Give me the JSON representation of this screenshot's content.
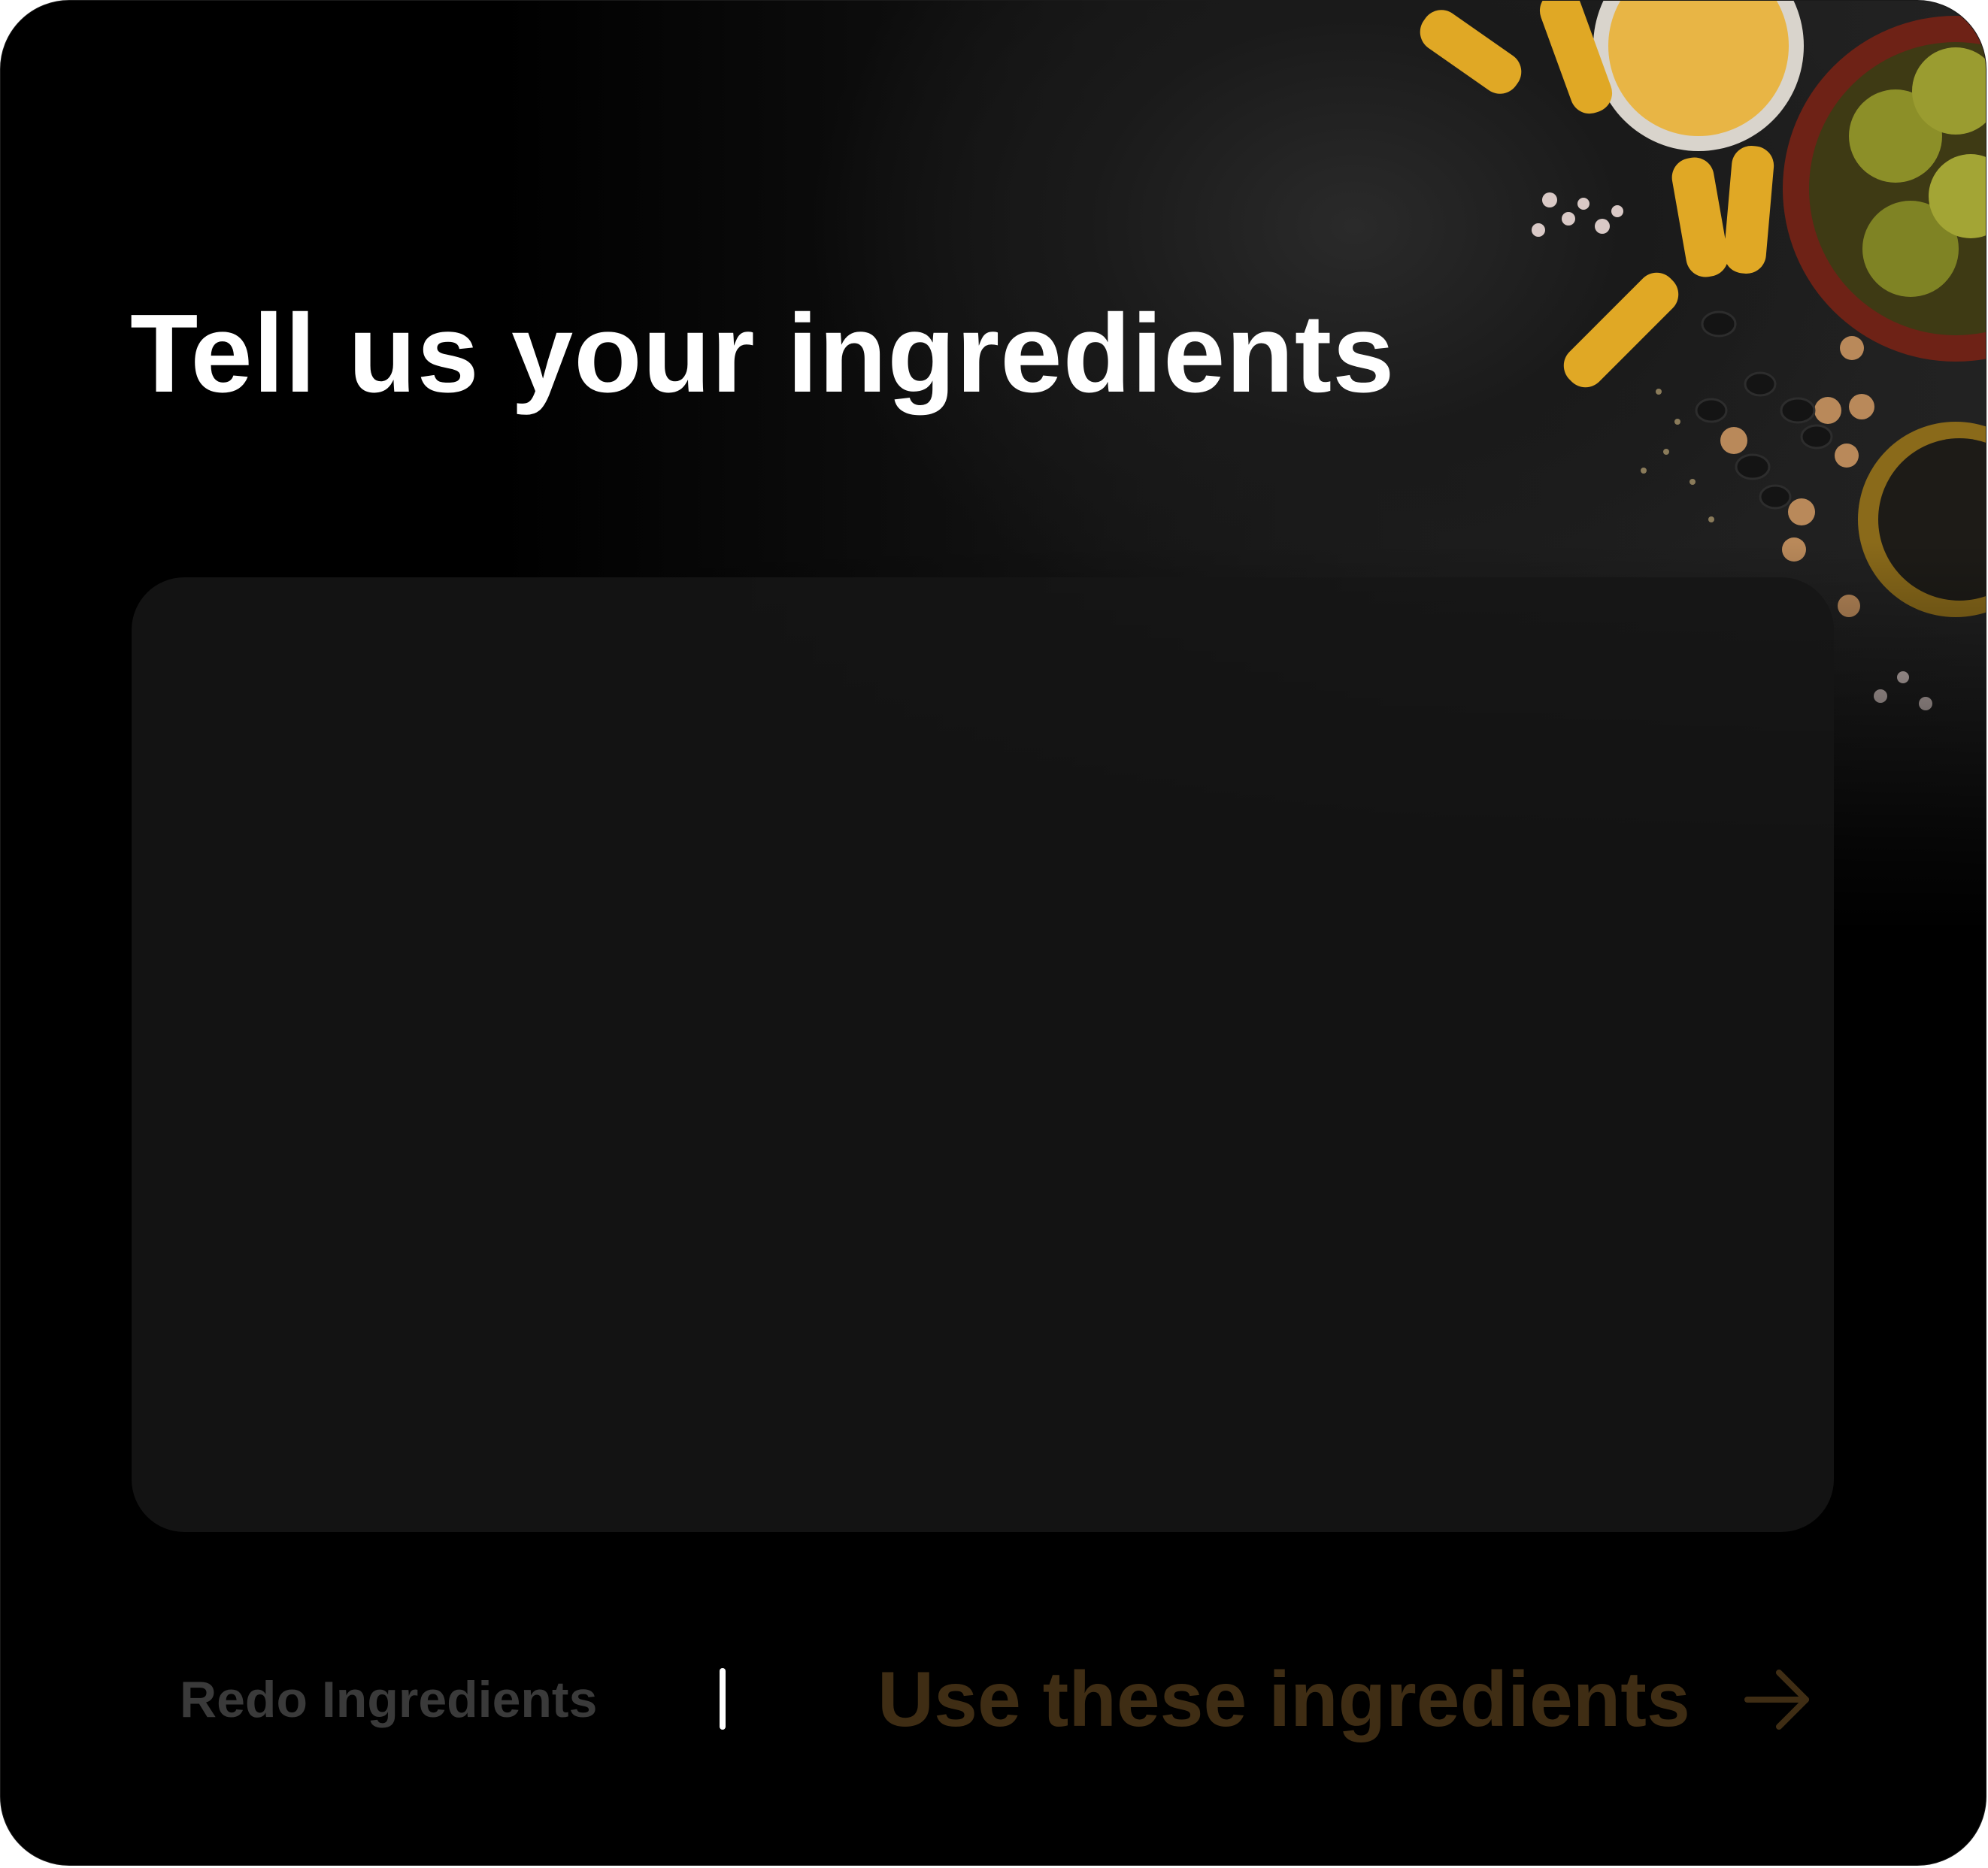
{
  "screen": {
    "title": "Tell us your ingredients"
  },
  "ingredients_input": {
    "value": "",
    "placeholder": ""
  },
  "footer": {
    "redo_label": "Redo Ingredients",
    "use_label": "Use these ingredients",
    "arrow_icon": "arrow-right-icon"
  },
  "colors": {
    "background": "#000000",
    "title": "#ffffff",
    "input_background": "#161616",
    "redo_text": "#3a3a3a",
    "use_text": "#3f2d14",
    "divider": "#ffffff"
  },
  "background_image": {
    "subject": "food-photo-pasta-olives-spices"
  }
}
